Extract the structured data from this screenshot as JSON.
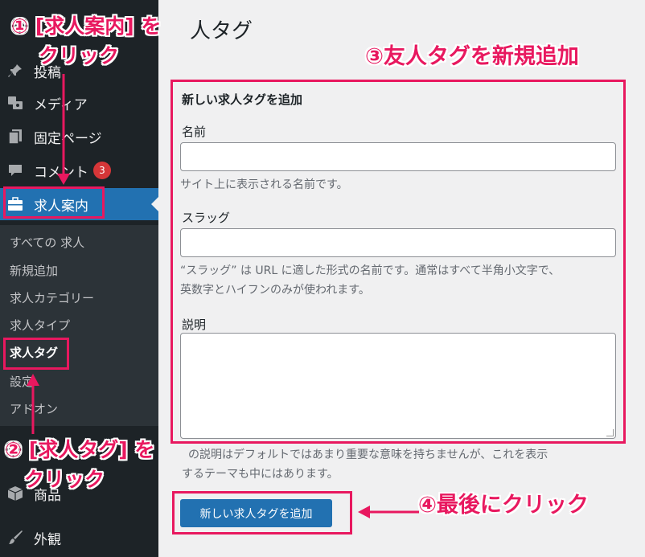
{
  "sidebar": {
    "menu": [
      {
        "label": "投稿",
        "icon": "pin-icon"
      },
      {
        "label": "メディア",
        "icon": "media-icon"
      },
      {
        "label": "固定ページ",
        "icon": "page-icon"
      },
      {
        "label": "コメント",
        "icon": "comment-icon",
        "badge": "3"
      },
      {
        "label": "求人案内",
        "icon": "briefcase-icon",
        "active": true
      },
      {
        "label": "商品",
        "icon": "box-icon"
      },
      {
        "label": "外観",
        "icon": "brush-icon"
      }
    ],
    "submenu": [
      "すべての 求人",
      "新規追加",
      "求人カテゴリー",
      "求人タイプ",
      "求人タグ",
      "設定",
      "アドオン"
    ],
    "current_submenu": "求人タグ"
  },
  "main": {
    "page_title": "人タグ",
    "form_heading": "新しい求人タグを追加",
    "name_label": "名前",
    "name_help": "サイト上に表示される名前です。",
    "slug_label": "スラッグ",
    "slug_help_1": "“スラッグ” は URL に適した形式の名前です。通常はすべて半角小文字で、",
    "slug_help_2": "英数字とハイフンのみが使われます。",
    "desc_label": "説明",
    "desc_help_1": "の説明はデフォルトではあまり重要な意味を持ちませんが、これを表示",
    "desc_help_2": "するテーマも中にはあります。",
    "submit_label": "新しい求人タグを追加"
  },
  "annotations": {
    "step1_line1": "① [求人案内] を",
    "step1_line2": "クリック",
    "step2_line1": "② [求人タグ] を",
    "step2_line2": "クリック",
    "step3": "③友人タグを新規追加",
    "step4": "④最後にクリック",
    "color": "#e8185f"
  },
  "colors": {
    "sidebar_bg": "#1d2327",
    "submenu_bg": "#2c3338",
    "active_bg": "#2271b1",
    "badge_bg": "#d63638",
    "button_bg": "#2271b1"
  }
}
